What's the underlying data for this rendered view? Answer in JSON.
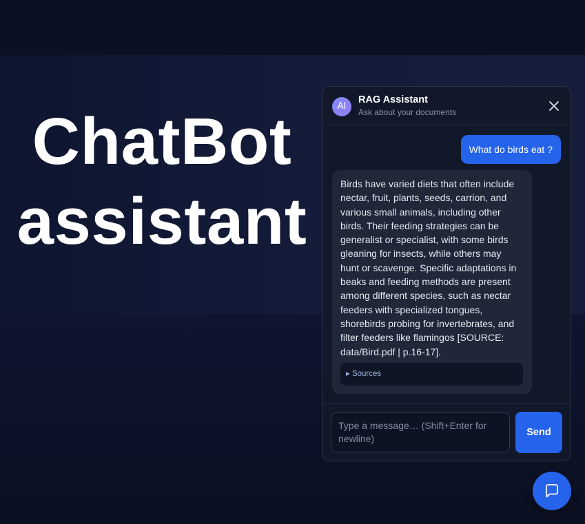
{
  "hero": {
    "line1": "ChatBot",
    "line2": "assistant"
  },
  "chat": {
    "avatar_label": "AI",
    "title": "RAG Assistant",
    "subtitle": "Ask about your documents",
    "close_icon": "close-icon",
    "messages": [
      {
        "role": "user",
        "text": "What do birds eat ?"
      },
      {
        "role": "assistant",
        "text": "Birds have varied diets that often include\nnectar, fruit, plants, seeds, carrion, and\nvarious small animals, including other\nbirds. Their feeding strategies can be\ngeneralist or specialist, with some birds\ngleaning for insects, while others may\nhunt or scavenge. Specific adaptations in\nbeaks and feeding methods are present\namong different species, such as nectar\nfeeders with specialized tongues,\nshorebirds probing for invertebrates, and\nfilter feeders like flamingos [SOURCE:\ndata/Bird.pdf | p.16-17]."
      }
    ],
    "sources_label": "▸ Sources",
    "input": {
      "value": "",
      "placeholder": "Type a message… (Shift+Enter for newline)"
    },
    "send_label": "Send"
  },
  "launcher": {
    "icon": "chat-bubble-icon"
  },
  "colors": {
    "accent": "#2563eb",
    "panel": "#111829",
    "bubble": "#1f2738",
    "background": "#0b1022"
  }
}
